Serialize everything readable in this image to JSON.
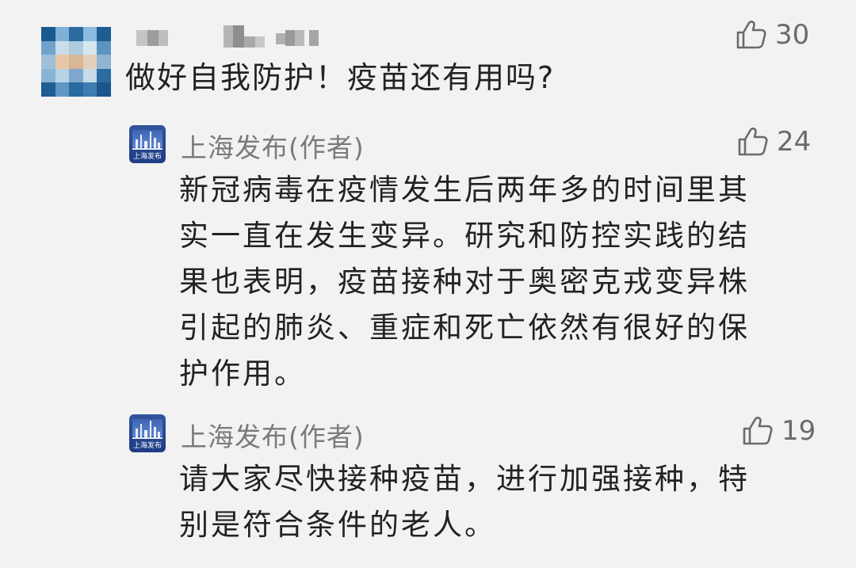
{
  "comment": {
    "text": "做好自我防护！疫苗还有用吗?",
    "likes": "30"
  },
  "replies": [
    {
      "author": "上海发布(作者)",
      "avatar_text": "上海发布",
      "likes": "24",
      "text": "新冠病毒在疫情发生后两年多的时间里其\n实一直在发生变异。研究和防控实践的结\n果也表明，疫苗接种对于奥密克戎变异株\n引起的肺炎、重症和死亡依然有很好的保\n护作用。"
    },
    {
      "author": "上海发布(作者)",
      "avatar_text": "上海发布",
      "likes": "19",
      "text": "请大家尽快接种疫苗，进行加强接种，特\n别是符合条件的老人。"
    }
  ],
  "icons": {
    "like": "thumbs-up-icon"
  },
  "colors": {
    "background": "#f2f2f2",
    "text": "#222222",
    "meta": "#7a7a7a",
    "avatar_blue": "#1f3d86"
  }
}
